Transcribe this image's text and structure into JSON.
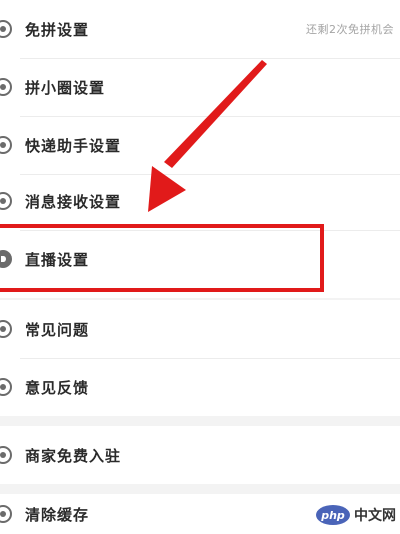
{
  "settings": {
    "items": [
      {
        "label": "免拼设置",
        "note": "还剩2次免拼机会"
      },
      {
        "label": "拼小圈设置"
      },
      {
        "label": "快递助手设置"
      },
      {
        "label": "消息接收设置"
      },
      {
        "label": "直播设置"
      },
      {
        "label": "常见问题"
      },
      {
        "label": "意见反馈"
      },
      {
        "label": "商家免费入驻"
      },
      {
        "label": "清除缓存"
      }
    ]
  },
  "watermark": {
    "logo": "php",
    "text": "中文网"
  },
  "colors": {
    "highlight": "#e11a1a",
    "divider_bg": "#f3f3f3"
  }
}
